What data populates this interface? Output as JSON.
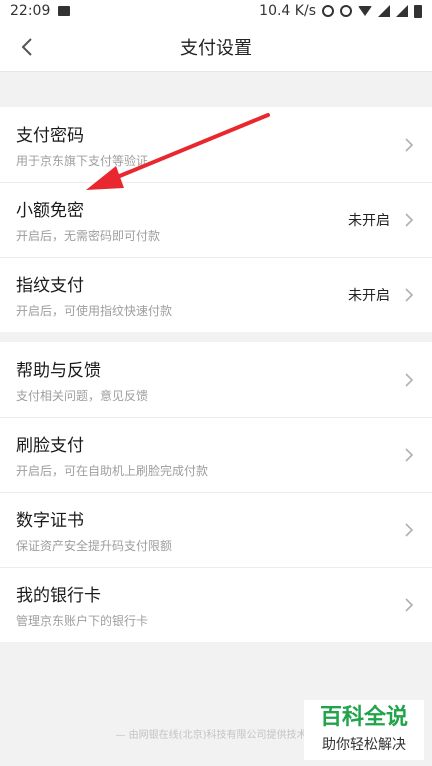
{
  "statusbar": {
    "time": "22:09",
    "network_speed": "10.4 K/s",
    "icons": [
      "image-icon",
      "alarm-icon",
      "mute-icon",
      "wifi-icon",
      "signal-icon",
      "signal-icon",
      "battery-icon"
    ]
  },
  "navbar": {
    "title": "支付设置",
    "back_icon": "chevron-left-icon"
  },
  "groups": [
    {
      "items": [
        {
          "title": "支付密码",
          "subtitle": "用于京东旗下支付等验证",
          "status": ""
        },
        {
          "title": "小额免密",
          "subtitle": "开启后，无需密码即可付款",
          "status": "未开启"
        },
        {
          "title": "指纹支付",
          "subtitle": "开启后，可使用指纹快速付款",
          "status": "未开启"
        }
      ]
    },
    {
      "items": [
        {
          "title": "帮助与反馈",
          "subtitle": "支付相关问题，意见反馈"
        },
        {
          "title": "刷脸支付",
          "subtitle": "开启后，可在自助机上刷脸完成付款"
        },
        {
          "title": "数字证书",
          "subtitle": "保证资产安全提升码支付限额"
        },
        {
          "title": "我的银行卡",
          "subtitle": "管理京东账户下的银行卡"
        }
      ]
    }
  ],
  "footer": {
    "text": "— 由网银在线(北京)科技有限公司提供技术支"
  },
  "watermark": {
    "big": "百科全说",
    "small": "助你轻松解决"
  },
  "colors": {
    "annotation_arrow": "#e8272f",
    "watermark_green": "#21a34a"
  }
}
